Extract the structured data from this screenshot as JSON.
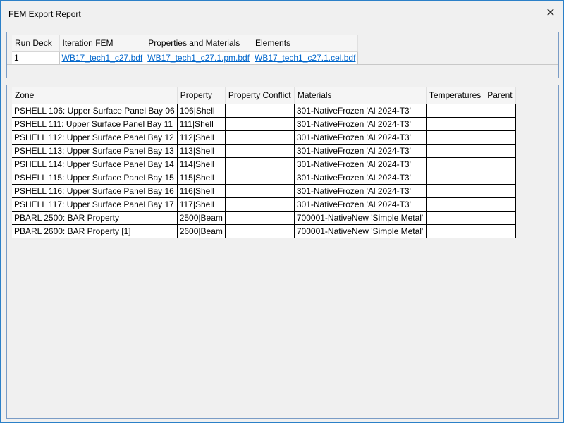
{
  "window": {
    "title": "FEM Export Report",
    "close_icon": "close-icon"
  },
  "run_table": {
    "columns": [
      "Run Deck",
      "Iteration FEM",
      "Properties and Materials",
      "Elements"
    ],
    "rows": [
      {
        "run_deck": "1",
        "iteration_fem": "WB17_tech1_c27.bdf",
        "properties_materials": "WB17_tech1_c27.1.pm.bdf",
        "elements": "WB17_tech1_c27.1.cel.bdf"
      }
    ]
  },
  "zone_table": {
    "columns": [
      "Zone",
      "Property",
      "Property Conflict",
      "Materials",
      "Temperatures",
      "Parent"
    ],
    "rows": [
      {
        "zone": "PSHELL 106: Upper Surface Panel Bay 06",
        "property": "106|Shell",
        "conflict": "",
        "materials": "301-NativeFrozen 'Al 2024-T3'",
        "temperatures": "",
        "parent": ""
      },
      {
        "zone": "PSHELL 111: Upper Surface Panel Bay 11",
        "property": "111|Shell",
        "conflict": "",
        "materials": "301-NativeFrozen 'Al 2024-T3'",
        "temperatures": "",
        "parent": ""
      },
      {
        "zone": "PSHELL 112: Upper Surface Panel Bay 12",
        "property": "112|Shell",
        "conflict": "",
        "materials": "301-NativeFrozen 'Al 2024-T3'",
        "temperatures": "",
        "parent": ""
      },
      {
        "zone": "PSHELL 113: Upper Surface Panel Bay 13",
        "property": "113|Shell",
        "conflict": "",
        "materials": "301-NativeFrozen 'Al 2024-T3'",
        "temperatures": "",
        "parent": ""
      },
      {
        "zone": "PSHELL 114: Upper Surface Panel Bay 14",
        "property": "114|Shell",
        "conflict": "",
        "materials": "301-NativeFrozen 'Al 2024-T3'",
        "temperatures": "",
        "parent": ""
      },
      {
        "zone": "PSHELL 115: Upper Surface Panel Bay 15",
        "property": "115|Shell",
        "conflict": "",
        "materials": "301-NativeFrozen 'Al 2024-T3'",
        "temperatures": "",
        "parent": ""
      },
      {
        "zone": "PSHELL 116: Upper Surface Panel Bay 16",
        "property": "116|Shell",
        "conflict": "",
        "materials": "301-NativeFrozen 'Al 2024-T3'",
        "temperatures": "",
        "parent": ""
      },
      {
        "zone": "PSHELL 117: Upper Surface Panel Bay 17",
        "property": "117|Shell",
        "conflict": "",
        "materials": "301-NativeFrozen 'Al 2024-T3'",
        "temperatures": "",
        "parent": ""
      },
      {
        "zone": "PBARL 2500: BAR Property",
        "property": "2500|Beam",
        "conflict": "",
        "materials": "700001-NativeNew 'Simple Metal'",
        "temperatures": "",
        "parent": ""
      },
      {
        "zone": "PBARL 2600: BAR Property [1]",
        "property": "2600|Beam",
        "conflict": "",
        "materials": "700001-NativeNew 'Simple Metal'",
        "temperatures": "",
        "parent": ""
      }
    ]
  },
  "colors": {
    "window_border": "#2b80c8",
    "link": "#0066cc",
    "background": "#f0f0f0"
  }
}
